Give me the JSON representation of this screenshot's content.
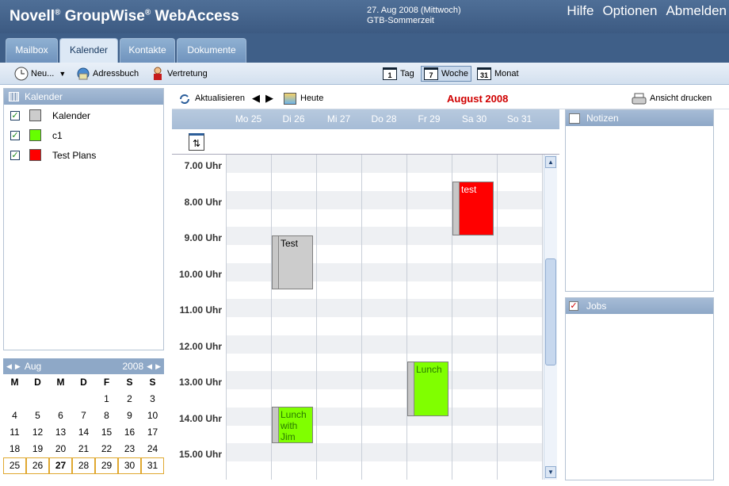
{
  "header": {
    "brand": "Novell",
    "reg": "®",
    "product": "GroupWise",
    "reg2": "®",
    "product2": "WebAccess",
    "date_line": "27. Aug 2008 (Mittwoch)",
    "tz_line": "GTB-Sommerzeit",
    "links": [
      "Hilfe",
      "Optionen",
      "Abmelden"
    ]
  },
  "tabs": [
    "Mailbox",
    "Kalender",
    "Kontakte",
    "Dokumente"
  ],
  "toolbar": {
    "new_label": "Neu...",
    "addressbook_label": "Adressbuch",
    "proxy_label": "Vertretung",
    "views": [
      {
        "num": "1",
        "label": "Tag"
      },
      {
        "num": "7",
        "label": "Woche"
      },
      {
        "num": "31",
        "label": "Monat"
      }
    ],
    "selected_view": "Woche"
  },
  "calendars": {
    "title": "Kalender",
    "items": [
      {
        "name": "Kalender",
        "color": "#cccccc"
      },
      {
        "name": "c1",
        "color": "#66ff00"
      },
      {
        "name": "Test Plans",
        "color": "#ff0000"
      }
    ]
  },
  "mini": {
    "month": "Aug",
    "year": "2008",
    "weekdays": [
      "M",
      "D",
      "M",
      "D",
      "F",
      "S",
      "S"
    ],
    "weeks": [
      [
        "",
        "",
        "",
        "",
        "1",
        "2",
        "3"
      ],
      [
        "4",
        "5",
        "6",
        "7",
        "8",
        "9",
        "10"
      ],
      [
        "11",
        "12",
        "13",
        "14",
        "15",
        "16",
        "17"
      ],
      [
        "18",
        "19",
        "20",
        "21",
        "22",
        "23",
        "24"
      ],
      [
        "25",
        "26",
        "27",
        "28",
        "29",
        "30",
        "31"
      ]
    ],
    "today": "27"
  },
  "nav": {
    "refresh_label": "Aktualisieren",
    "today_label": "Heute",
    "month_title": "August 2008",
    "print_label": "Ansicht drucken"
  },
  "days": [
    "Mo 25",
    "Di 26",
    "Mi 27",
    "Do 28",
    "Fr 29",
    "Sa 30",
    "So 31"
  ],
  "hours": [
    "7.00 Uhr",
    "8.00 Uhr",
    "9.00 Uhr",
    "10.00 Uhr",
    "11.00 Uhr",
    "12.00 Uhr",
    "13.00 Uhr",
    "14.00 Uhr",
    "15.00 Uhr"
  ],
  "appointments": [
    {
      "title": "test",
      "day": 5,
      "start": 7.5,
      "end": 9.0,
      "color": "#ff0000",
      "text_color": "#ffffff"
    },
    {
      "title": "Test",
      "day": 1,
      "start": 9.0,
      "end": 10.5,
      "color": "#cccccc",
      "text_color": "#000000"
    },
    {
      "title": "Lunch",
      "day": 4,
      "start": 12.5,
      "end": 14.0,
      "color": "#80ff00",
      "text_color": "#2a7a00"
    },
    {
      "title": "Lunch with Jim",
      "day": 1,
      "start": 13.75,
      "end": 14.75,
      "color": "#80ff00",
      "text_color": "#2a7a00"
    }
  ],
  "panels": {
    "notes": "Notizen",
    "tasks": "Jobs"
  }
}
